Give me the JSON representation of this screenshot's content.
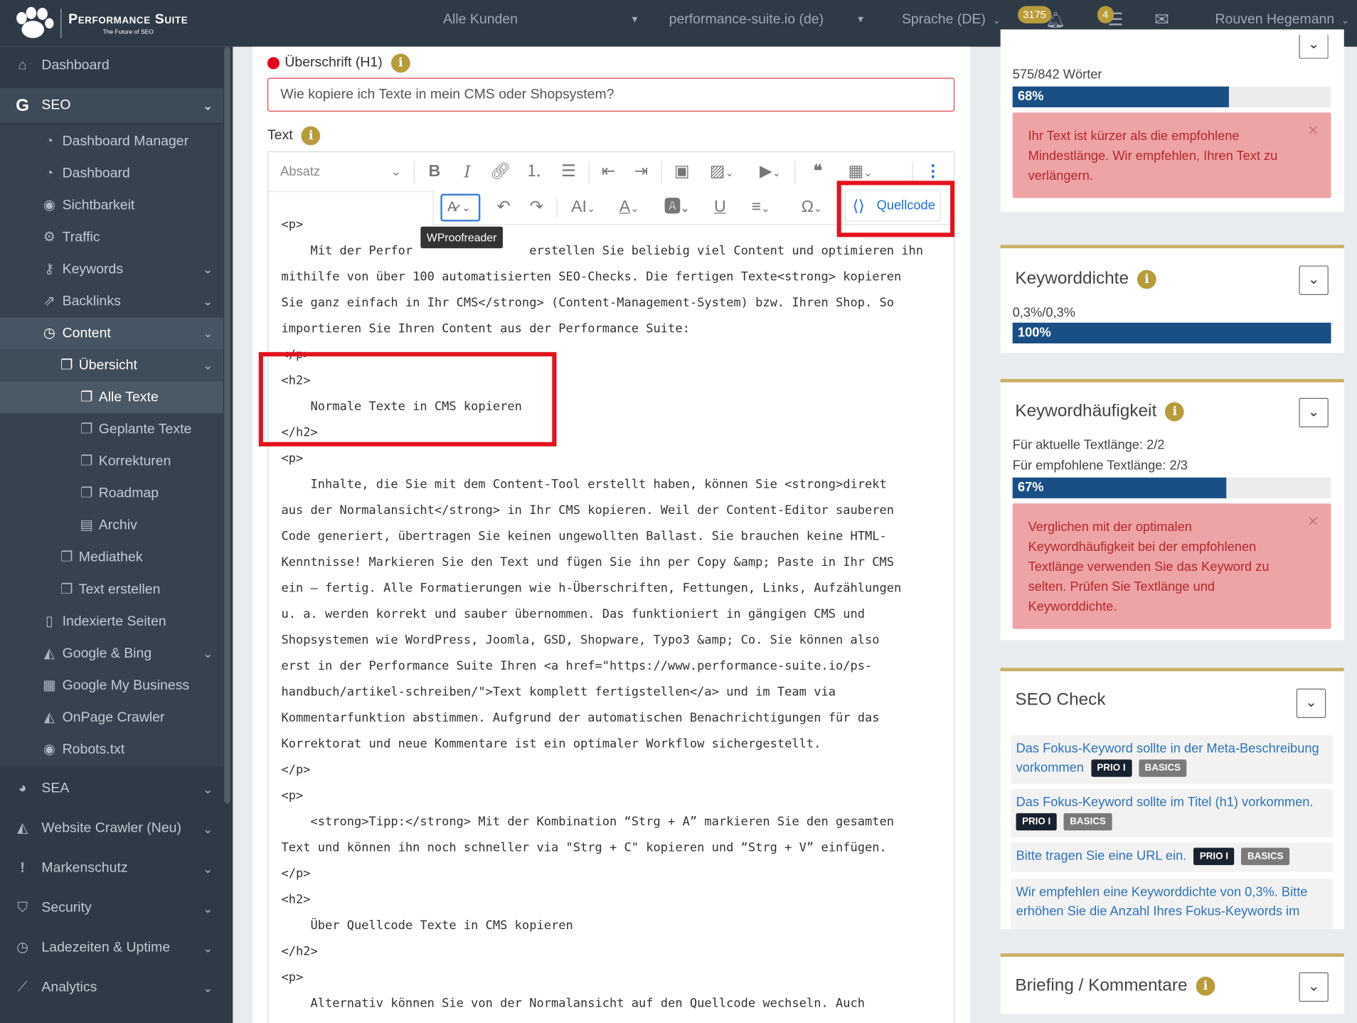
{
  "topbar": {
    "brand": "Performance Suite",
    "tagline": "The Future of SEO",
    "customer": "Alle Kunden",
    "domain": "performance-suite.io (de)",
    "language": "Sprache (DE)",
    "notif_count": "3175",
    "task_count": "4",
    "user": "Rouven Hegemann"
  },
  "sidebar": {
    "dashboard": "Dashboard",
    "seo": "SEO",
    "dashboard_manager": "Dashboard Manager",
    "seo_dashboard": "Dashboard",
    "sichtbarkeit": "Sichtbarkeit",
    "traffic": "Traffic",
    "keywords": "Keywords",
    "backlinks": "Backlinks",
    "content": "Content",
    "uebersicht": "Übersicht",
    "alle_texte": "Alle Texte",
    "geplante_texte": "Geplante Texte",
    "korrekturen": "Korrekturen",
    "roadmap": "Roadmap",
    "archiv": "Archiv",
    "mediathek": "Mediathek",
    "text_erstellen": "Text erstellen",
    "indexierte_seiten": "Indexierte Seiten",
    "google_bing": "Google & Bing",
    "google_my_business": "Google My Business",
    "onpage_crawler": "OnPage Crawler",
    "robots": "Robots.txt",
    "sea": "SEA",
    "website_crawler": "Website Crawler (Neu)",
    "markenschutz": "Markenschutz",
    "security": "Security",
    "ladezeiten": "Ladezeiten & Uptime",
    "analytics": "Analytics"
  },
  "editor": {
    "h1_label": "Überschrift (H1)",
    "h1_value": "Wie kopiere ich Texte in mein CMS oder Shopsystem?",
    "text_label": "Text",
    "format_select": "Absatz",
    "tooltip": "WProofreader",
    "source_button": "Quellcode",
    "code_lines": [
      "<p>",
      "    Mit der Perfor                erstellen Sie beliebig viel Content und optimieren ihn",
      "mithilfe von über 100 automatisierten SEO-Checks. Die fertigen Texte<strong> kopieren",
      "Sie ganz einfach in Ihr CMS</strong> (Content-Management-System) bzw. Ihren Shop. So",
      "importieren Sie Ihren Content aus der Performance Suite:",
      "</p>",
      "<h2>",
      "    Normale Texte in CMS kopieren",
      "</h2>",
      "<p>",
      "    Inhalte, die Sie mit dem Content-Tool erstellt haben, können Sie <strong>direkt",
      "aus der Normalansicht</strong> in Ihr CMS kopieren. Weil der Content-Editor sauberen",
      "Code generiert, übertragen Sie keinen ungewollten Ballast. Sie brauchen keine HTML-",
      "Kenntnisse! Markieren Sie den Text und fügen Sie ihn per Copy &amp; Paste in Ihr CMS",
      "ein – fertig. Alle Formatierungen wie h-Überschriften, Fettungen, Links, Aufzählungen",
      "u. a. werden korrekt und sauber übernommen. Das funktioniert in gängigen CMS und",
      "Shopsystemen wie WordPress, Joomla, GSD, Shopware, Typo3 &amp; Co. Sie können also",
      "erst in der Performance Suite Ihren <a href=\"https://www.performance-suite.io/ps-",
      "handbuch/artikel-schreiben/\">Text komplett fertigstellen</a> und im Team via",
      "Kommentarfunktion abstimmen. Aufgrund der automatischen Benachrichtigungen für das",
      "Korrektorat und neue Kommentare ist ein optimaler Workflow sichergestellt.",
      "</p>",
      "<p>",
      "    <strong>Tipp:</strong> Mit der Kombination “Strg + A” markieren Sie den gesamten",
      "Text und können ihn noch schneller via \"Strg + C\" kopieren und “Strg + V” einfügen.",
      "</p>",
      "<h2>",
      "    Über Quellcode Texte in CMS kopieren",
      "</h2>",
      "<p>",
      "    Alternativ können Sie von der Normalansicht auf den Quellcode wechseln. Auch"
    ]
  },
  "right": {
    "wortanzahl": {
      "count": "575/842 Wörter",
      "percent_label": "68%",
      "percent": 68,
      "alert": "Ihr Text ist kürzer als die empfohlene Mindestlänge. Wir empfehlen, Ihren Text zu verlängern."
    },
    "keyworddichte": {
      "title": "Keyworddichte",
      "value": "0,3%/0,3%",
      "percent_label": "100%",
      "percent": 100
    },
    "keywordhaeufigkeit": {
      "title": "Keywordhäufigkeit",
      "current": "Für aktuelle Textlänge: 2/2",
      "recommended": "Für empfohlene Textlänge: 2/3",
      "percent_label": "67%",
      "percent": 67,
      "alert": "Verglichen mit der optimalen Keywordhäufigkeit bei der empfohlenen Textlänge verwenden Sie das Keyword zu selten. Prüfen Sie Textlänge und Keyworddichte."
    },
    "seo_check": {
      "title": "SEO Check",
      "items": [
        {
          "text": "Das Fokus-Keyword sollte in der Meta-Beschreibung vorkommen",
          "prio": "PRIO I",
          "tag": "BASICS"
        },
        {
          "text": "Das Fokus-Keyword sollte im Titel (h1) vorkommen.",
          "prio": "PRIO I",
          "tag": "BASICS"
        },
        {
          "text": "Bitte tragen Sie eine URL ein.",
          "prio": "PRIO I",
          "tag": "BASICS"
        },
        {
          "text": "Wir empfehlen eine Keyworddichte von 0,3%. Bitte erhöhen Sie die Anzahl Ihres Fokus-Keywords im"
        }
      ]
    },
    "briefing": {
      "title": "Briefing / Kommentare"
    }
  },
  "colors": {
    "sidebar_bg": "#2f3a47",
    "accent_gold": "#b89c3c",
    "bar_blue": "#1a4f85",
    "alert_bg": "#eea4a6",
    "highlight_red": "#e3121d"
  }
}
